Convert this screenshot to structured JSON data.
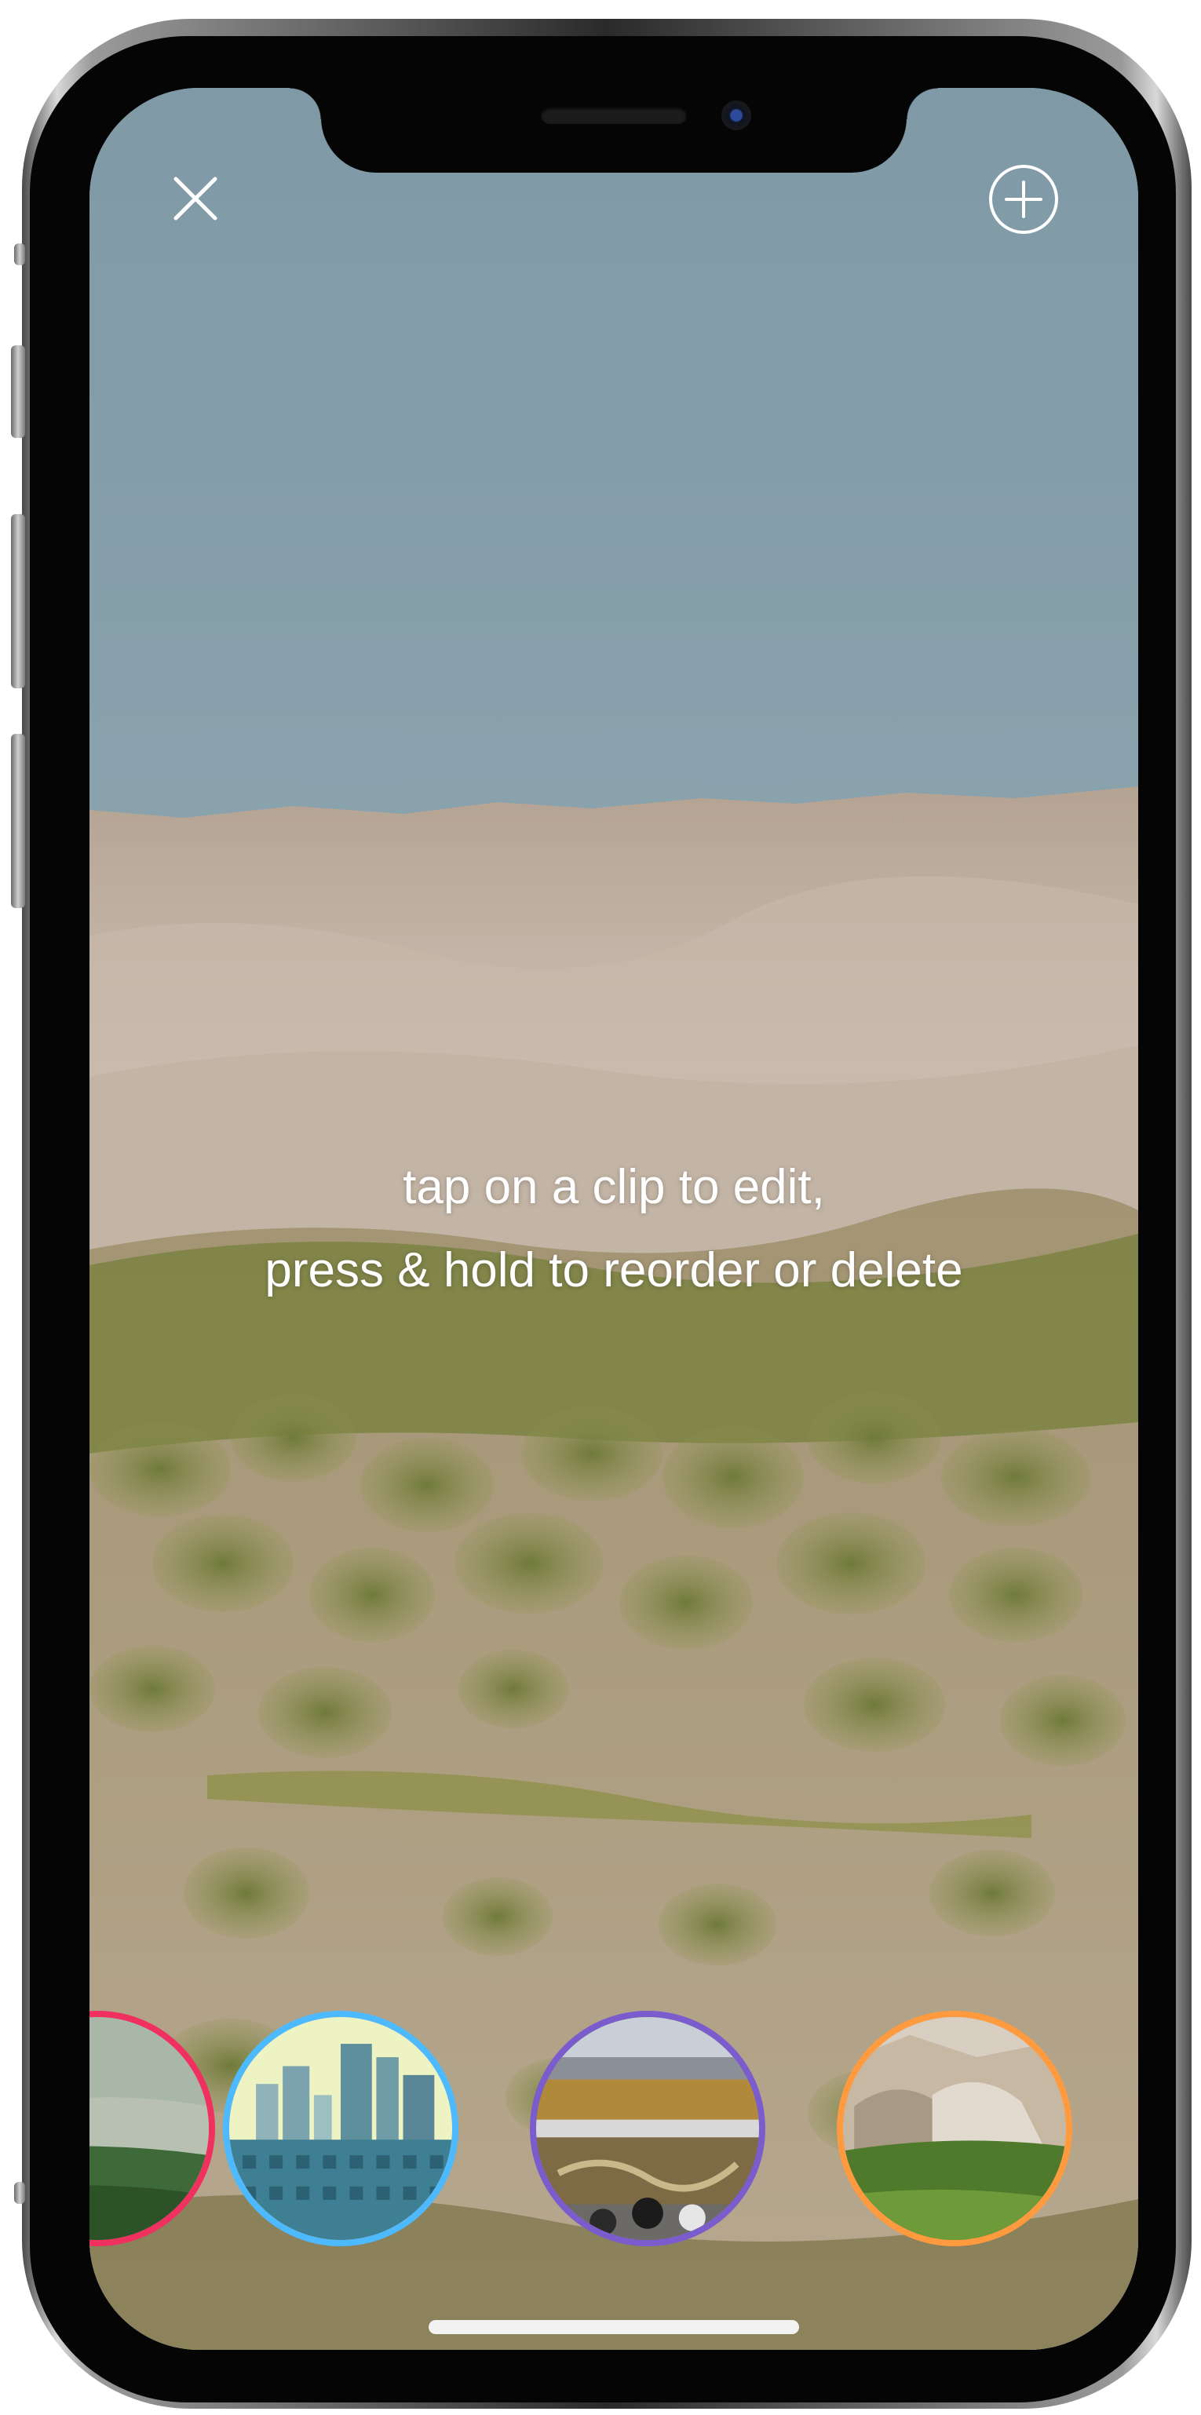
{
  "hint": {
    "line1": "tap on a clip to edit,",
    "line2": "press & hold to reorder or delete"
  },
  "controls": {
    "close_icon": "close-icon",
    "add_icon": "add-circle-icon"
  },
  "clips": [
    {
      "name": "clip-1",
      "ring_color": "#f0305e",
      "scene": "green hills"
    },
    {
      "name": "clip-2",
      "ring_color": "#4db9ff",
      "scene": "city skyline"
    },
    {
      "name": "clip-3",
      "ring_color": "#7a5ccc",
      "scene": "stadium arena"
    },
    {
      "name": "clip-4",
      "ring_color": "#ff9a3e",
      "scene": "rocky landscape"
    }
  ],
  "colors": {
    "sky": "#8aa3ad",
    "text": "#ffffff"
  }
}
